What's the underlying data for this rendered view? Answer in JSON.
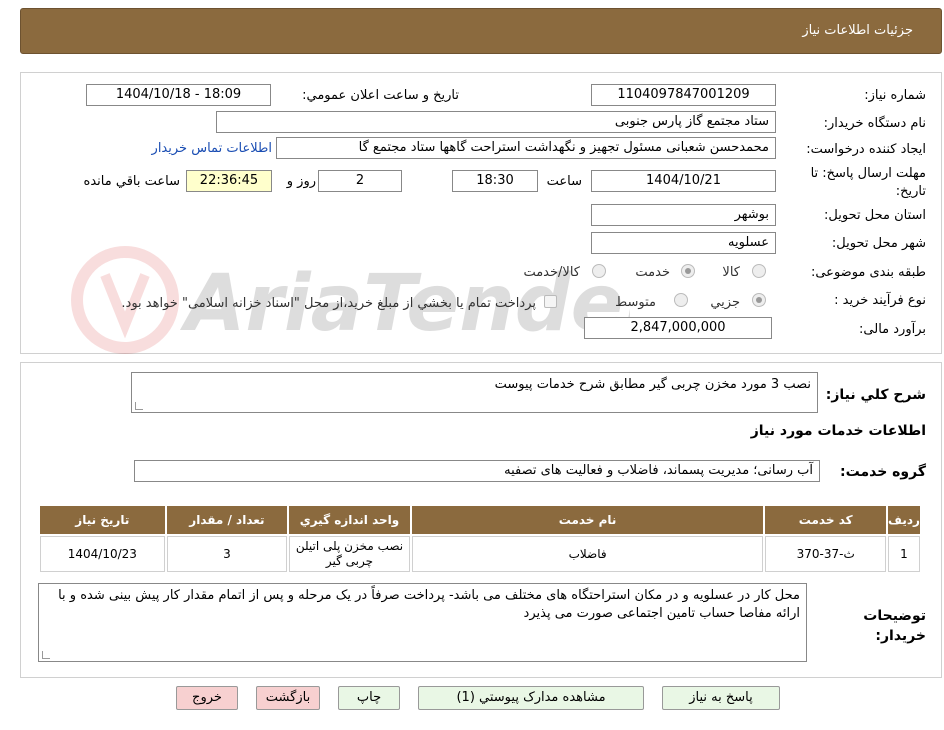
{
  "header": {
    "title": "جزئیات اطلاعات نیاز"
  },
  "form": {
    "need_number_label": "شماره نیاز:",
    "need_number": "1104097847001209",
    "announce_label": "تاریخ و ساعت اعلان عمومي:",
    "announce_value": "1404/10/18 - 18:09",
    "buyer_label": "نام دستگاه خريدار:",
    "buyer_value": "ستاد مجتمع گاز پارس جنوبی",
    "creator_label": "ايجاد کننده درخواست:",
    "creator_value": "محمدحسن شعبانی مسئول تجهیز و نگهداشت استراحت گاهها ستاد مجتمع گا",
    "contact_link": "اطلاعات تماس خريدار",
    "deadline_label": "مهلت ارسال پاسخ: تا تاریخ:",
    "deadline_date": "1404/10/21",
    "time_label": "ساعت",
    "deadline_time": "18:30",
    "days_value": "2",
    "days_label": "روز و",
    "remaining_time": "22:36:45",
    "remaining_label": "ساعت باقي مانده",
    "province_label": "استان محل تحویل:",
    "province_value": "بوشهر",
    "city_label": "شهر محل تحویل:",
    "city_value": "عسلویه",
    "category_label": "طبقه بندی موضوعی:",
    "category_options": [
      "کالا",
      "خدمت",
      "کالا/خدمت"
    ],
    "category_selected": "خدمت",
    "process_label": "نوع فرآیند خرید :",
    "process_options": [
      "جزیي",
      "متوسط"
    ],
    "process_selected": "جزیي",
    "payment_note": "پرداخت تمام يا بخشي از مبلغ خريد،از محل \"اسناد خزانه اسلامی\" خواهد بود.",
    "budget_label": "برآورد مالی:",
    "budget_value": "2,847,000,000"
  },
  "description": {
    "summary_label": "شرح کلي نياز:",
    "summary_value": "نصب 3 مورد مخزن چربی گیر مطابق شرح خدمات پیوست",
    "services_title": "اطلاعات خدمات مورد نياز",
    "group_label": "گروه خدمت:",
    "group_value": "آب رسانی؛ مدیریت پسماند، فاضلاب و فعالیت های تصفیه"
  },
  "table": {
    "headers": [
      "رديف",
      "کد خدمت",
      "نام خدمت",
      "واحد اندازه گيري",
      "تعداد / مقدار",
      "تاريخ نياز"
    ],
    "rows": [
      {
        "index": "1",
        "code": "ث-37-370",
        "name": "فاضلاب",
        "unit": "نصب مخزن پلی اتیلن چربی گیر",
        "qty": "3",
        "date": "1404/10/23"
      }
    ]
  },
  "notes": {
    "label": "توضيحات خريدار:",
    "value": "محل کار در عسلویه و در مکان استراحتگاه های مختلف می باشد- پرداخت صرفاً در یک مرحله و پس از اتمام مقدار کار پیش بینی شده و با ارائه مفاصا حساب تامین اجتماعی صورت می پذیرد"
  },
  "buttons": {
    "reply": "پاسخ به نياز",
    "attachments": "مشاهده مدارک پيوستي (1)",
    "print": "چاپ",
    "back": "بازگشت",
    "exit": "خروج"
  },
  "colors": {
    "header_bg": "#8b6a3e",
    "link": "#1a4db3",
    "remaining_bg": "#ffffcc",
    "button_green": "#e9f7e5",
    "button_red": "#f7d0d0"
  }
}
